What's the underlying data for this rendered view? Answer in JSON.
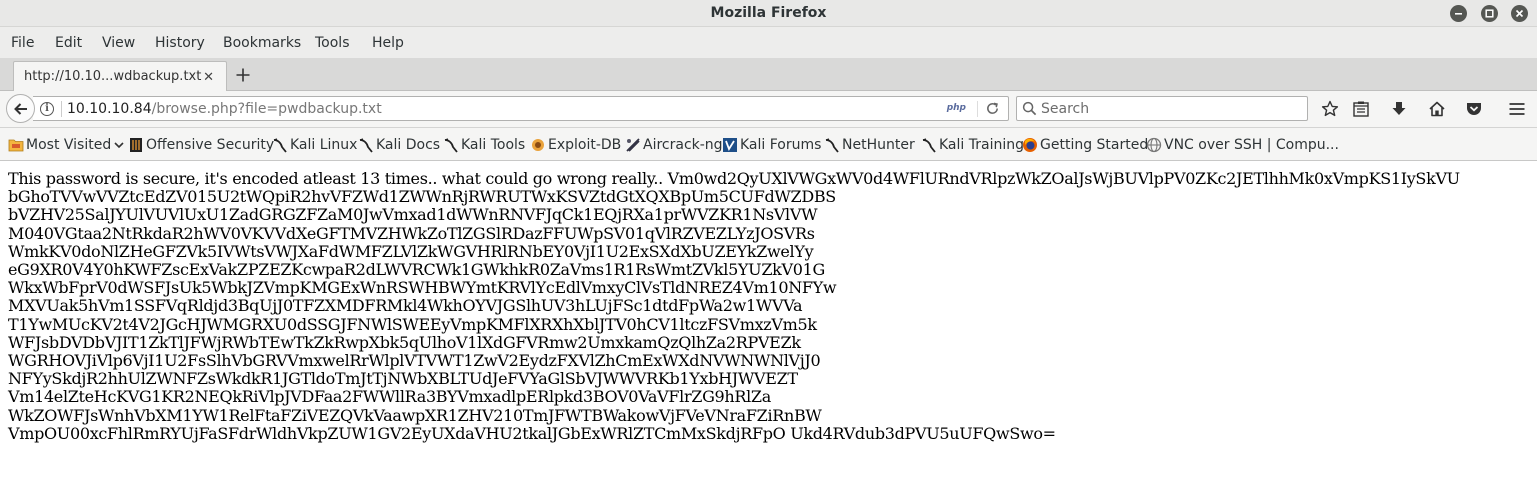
{
  "window": {
    "title": "Mozilla Firefox"
  },
  "menu": [
    "File",
    "Edit",
    "View",
    "History",
    "Bookmarks",
    "Tools",
    "Help"
  ],
  "tab": {
    "label": "http://10.10...wdbackup.txt",
    "close": "✕"
  },
  "urlbar": {
    "host": "10.10.10.84",
    "path": "/browse.php?file=pwdbackup.txt",
    "badge": "php"
  },
  "search": {
    "placeholder": "Search"
  },
  "bookmarks": [
    "Most Visited",
    "Offensive Security",
    "Kali Linux",
    "Kali Docs",
    "Kali Tools",
    "Exploit-DB",
    "Aircrack-ng",
    "Kali Forums",
    "NetHunter",
    "Kali Training",
    "Getting Started",
    "VNC over SSH | Compu..."
  ],
  "content": {
    "lines": [
      "This password is secure, it's encoded atleast 13 times.. what could go wrong really.. Vm0wd2QyUXlVWGxWV0d4WFlURndVRlpzWkZOalJsWjBUVlpPV0ZKc2JETlhhMk0xVmpKS1IySkVU",
      "bGhoTVVwVVZtcEdZV015U2tWQpiR2hvVFZWd1ZWWnRjRWRUTWxKSVZtdGtXQXBpUm5CUFdWZDBS",
      "bVZHV25SalJYUlVUVlUxU1ZadGRGZFZaM0JwVmxad1dWWnRNVFJqCk1EQjRXa1prWVZKR1NsVlVW",
      "M040VGtaa2NtRkdaR2hWV0VKVVdXeGFTMVZHWkZoTlZGSlRDazFFUWpSV01qVlRZVEZLYzJOSVRs",
      "WmkKV0doNlZHeGFZVk5IVWtsVWJXaFdWMFZLVlZkWGVHRlRNbEY0VjI1U2ExSXdXbUZEYkZwelYy",
      "eG9XR0V4Y0hKWFZscExVakZPZEZKcwpaR2dLWVRCWk1GWkhkR0ZaVms1R1RsWmtZVkl5YUZkV01G",
      "WkxWbFprV0dWSFJsUk5WbkJZVmpKMGExWnRSWHBWYmtKRVlYcEdlVmxyClVsTldNREZ4Vm10NFYw",
      "MXVUak5hVm1SSFVqRldjd3BqUjJ0TFZXMDFRMkl4WkhOYVJGSlhUV3hLUjFSc1dtdFpWa2w1WVVa",
      "T1YwMUcKV2t4V2JGcHJWMGRXU0dSSGJFNWlSWEEyVmpKMFlXRXhXblJTV0hCV1ltczFSVmxzVm5k",
      "WFJsbDVDbVJIT1ZkTlJFWjRWbTEwTkZkRwpXbk5qUlhoV1lXdGFVRmw2UmxkamQzQlhZa2RPVEZk",
      "WGRHOVJiVlp6VjI1U2FsSlhVbGRVVmxwelRrWlplVTVWT1ZwV2EydzFXVlZhCmExWXdNVWNWNlVjJ0",
      "NFYySkdjR2hhUlZWNFZsWkdkR1JGTldoTmJtTjNWbXBLTUdJeFVYaGlSbVJWWVRKb1YxbHJWVEZT",
      "Vm14elZteHcKVG1KR2NEQkRiVlpJVDFaa2FWWllRa3BYVmxadlpERlpkd3BOV0VaVFlrZG9hRlZa",
      "WkZOWFJsWnhVbXM1YW1RelFtaFZiVEZQVkVaawpXR1ZHV210TmJFWTBWakowVjFVeVNraFZiRnBW",
      "VmpOU00xcFhlRmRYUjFaSFdrWldhVkpZUW1GV2EyUXdaVHU2tkalJGbExWRlZTCmMxSkdjRFpO Ukd4RVdub3dPVU5uUFQwSwo="
    ]
  }
}
